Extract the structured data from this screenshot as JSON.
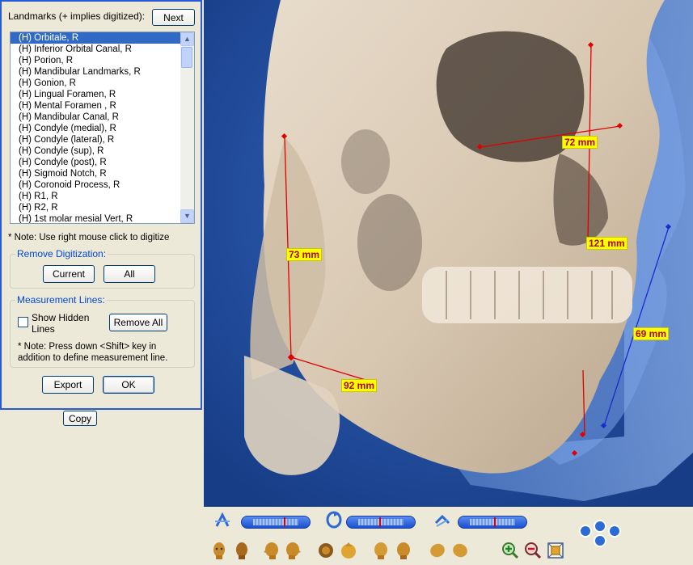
{
  "panel": {
    "landmarks_label": "Landmarks (+ implies digitized):",
    "next_label": "Next",
    "landmarks": [
      "(H) Orbitale, R",
      "(H) Inferior Orbital Canal, R",
      "(H) Porion, R",
      "(H) Mandibular Landmarks, R",
      "(H) Gonion, R",
      "(H) Lingual Foramen, R",
      "(H) Mental Foramen , R",
      "(H) Mandibular Canal, R",
      "(H) Condyle (medial), R",
      "(H) Condyle (lateral), R",
      "(H) Condyle (sup), R",
      "(H) Condyle (post), R",
      "(H) Sigmoid Notch, R",
      "(H) Coronoid Process, R",
      "(H) R1, R",
      "(H) R2, R",
      "(H) 1st molar mesial Vert, R"
    ],
    "selected_index": 0,
    "note_digitize": "* Note: Use right mouse click to digitize",
    "remove_group_label": "Remove Digitization:",
    "current_label": "Current",
    "all_label": "All",
    "measure_group_label": "Measurement Lines:",
    "show_hidden_line1": "Show Hidden",
    "show_hidden_line2": "Lines",
    "remove_all_label": "Remove All",
    "note_shift": "* Note: Press down <Shift> key in addition to define measurement line.",
    "export_label": "Export",
    "ok_label": "OK",
    "copy_label": "Copy"
  },
  "measurements": [
    {
      "label": "73 mm"
    },
    {
      "label": "92 mm"
    },
    {
      "label": "72 mm"
    },
    {
      "label": "121 mm"
    },
    {
      "label": "69 mm"
    }
  ],
  "colors": {
    "background": "#1f4fa0",
    "measure_line_red": "#e00000",
    "measure_line_blue": "#1a2ad0",
    "label_bg": "#ffff00",
    "label_text": "#b00000"
  },
  "toolbar": {
    "icons": [
      "rotate-x-icon",
      "rotate-y-icon",
      "rotate-z-icon",
      "zoom-in-icon",
      "zoom-out-icon",
      "fit-icon",
      "navigate-icon"
    ]
  }
}
